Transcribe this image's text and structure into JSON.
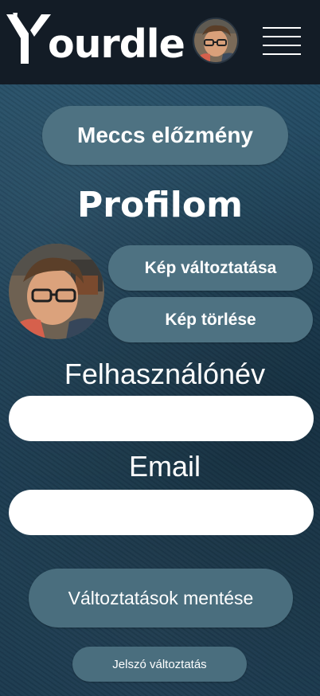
{
  "navbar": {
    "logo_text": "ourdle",
    "avatar_icon": "user-avatar",
    "menu_icon": "hamburger-menu-icon"
  },
  "buttons": {
    "match_history": "Meccs előzmény",
    "change_picture": "Kép változtatása",
    "delete_picture": "Kép törlése",
    "save_changes": "Változtatások mentése",
    "change_password": "Jelszó változtatás"
  },
  "profile": {
    "title": "Profilom",
    "avatar_icon": "profile-avatar"
  },
  "form": {
    "username_label": "Felhasználónév",
    "username_value": "",
    "email_label": "Email",
    "email_value": ""
  },
  "colors": {
    "navbar_bg": "#131c26",
    "button_bg": "#4e7282",
    "page_bg": "#1d3d52"
  }
}
